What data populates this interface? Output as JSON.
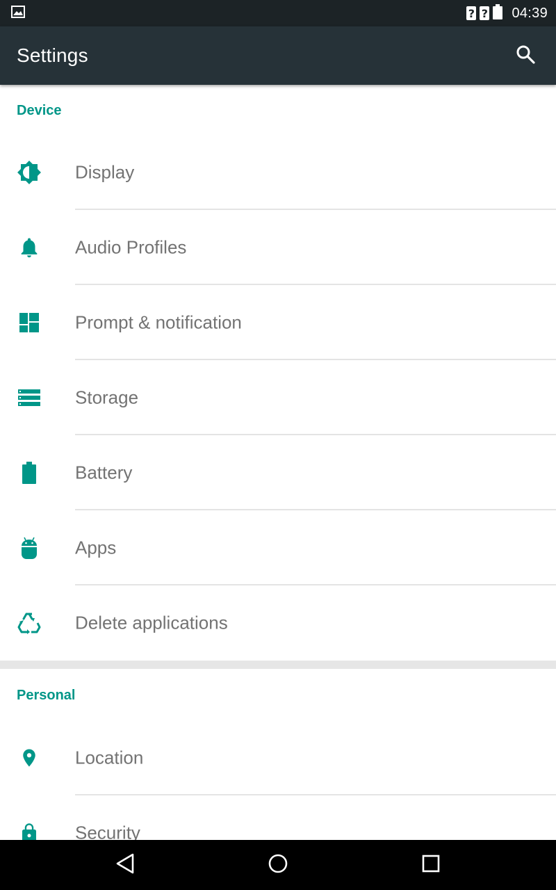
{
  "status_bar": {
    "time": "04:39",
    "sim1": "?",
    "sim2": "?",
    "icons": [
      "image-notification-icon",
      "sim-unknown-icon",
      "sim-unknown-icon",
      "battery-icon"
    ]
  },
  "app_bar": {
    "title": "Settings",
    "search_icon": "search-icon"
  },
  "sections": [
    {
      "header": "Device",
      "items": [
        {
          "label": "Display",
          "icon": "brightness-icon"
        },
        {
          "label": "Audio Profiles",
          "icon": "bell-icon"
        },
        {
          "label": "Prompt & notification",
          "icon": "grid-icon"
        },
        {
          "label": "Storage",
          "icon": "storage-icon"
        },
        {
          "label": "Battery",
          "icon": "battery-icon"
        },
        {
          "label": "Apps",
          "icon": "android-icon"
        },
        {
          "label": "Delete applications",
          "icon": "recycle-icon"
        }
      ]
    },
    {
      "header": "Personal",
      "items": [
        {
          "label": "Location",
          "icon": "location-pin-icon"
        },
        {
          "label": "Security",
          "icon": "lock-icon"
        }
      ]
    }
  ],
  "nav_bar": {
    "buttons": [
      "back-icon",
      "home-icon",
      "recents-icon"
    ]
  },
  "colors": {
    "accent": "#009688",
    "app_bar": "#263238",
    "status_bar": "#1c2326",
    "item_text": "#737373",
    "background": "#e6e6e6"
  }
}
